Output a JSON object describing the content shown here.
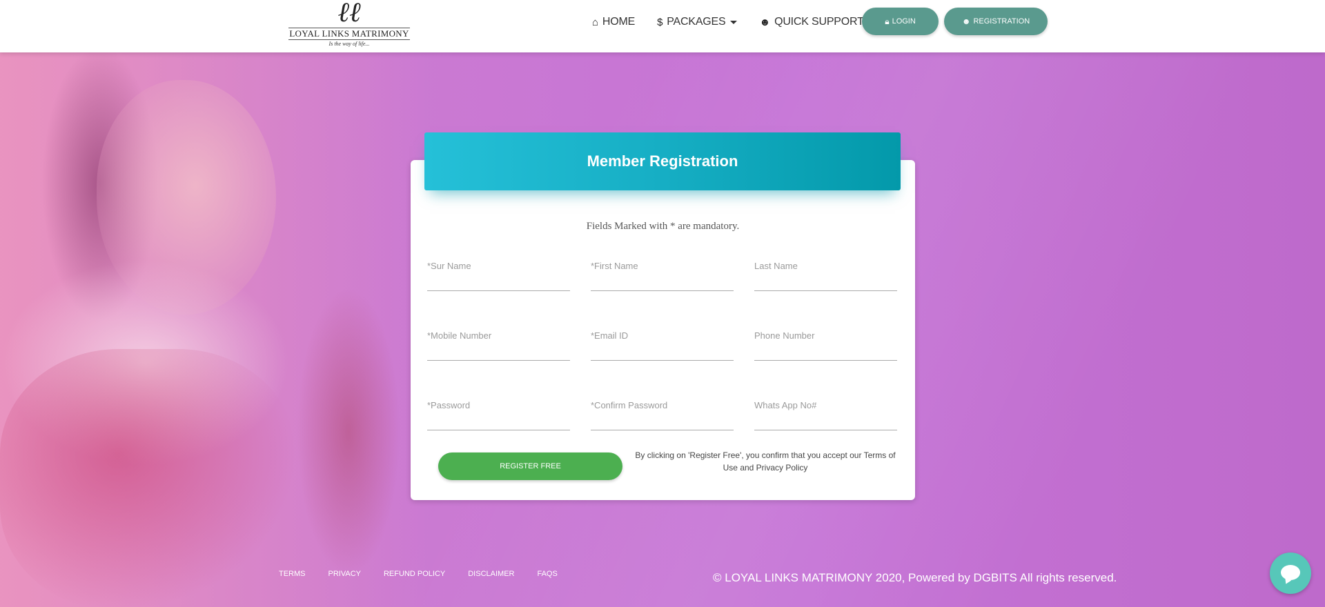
{
  "logo": {
    "mark": "ℓℓ",
    "name": "LOYAL LINKS MATRIMONY",
    "tagline": "Is the way of life..."
  },
  "nav": {
    "home": {
      "label": "HOME",
      "icon": "home-icon"
    },
    "packages": {
      "label": "PACKAGES",
      "icon": "dollar-icon"
    },
    "support": {
      "label": "QUICK SUPPORT",
      "icon": "people-icon"
    },
    "login": {
      "label": "LOGIN",
      "icon": "lock-icon"
    },
    "registration": {
      "label": "REGISTRATION",
      "icon": "user-add-icon"
    }
  },
  "form": {
    "title": "Member Registration",
    "mandatory_note": "Fields Marked with * are mandatory.",
    "fields": [
      {
        "label": "*Sur Name",
        "value": ""
      },
      {
        "label": "*First Name",
        "value": ""
      },
      {
        "label": "Last Name",
        "value": ""
      },
      {
        "label": "*Mobile Number",
        "value": ""
      },
      {
        "label": "*Email ID",
        "value": ""
      },
      {
        "label": "Phone Number",
        "value": ""
      },
      {
        "label": "*Password",
        "value": ""
      },
      {
        "label": "*Confirm Password",
        "value": ""
      },
      {
        "label": "Whats App No#",
        "value": ""
      }
    ],
    "submit_label": "REGISTER FREE",
    "terms_text": "By clicking on 'Register Free', you confirm that you accept our Terms of Use and Privacy Policy"
  },
  "footer": {
    "links": [
      "TERMS",
      "PRIVACY",
      "REFUND POLICY",
      "DISCLAIMER",
      "FAQS"
    ],
    "copyright": "© LOYAL LINKS MATRIMONY 2020, Powered by DGBITS All rights reserved."
  },
  "colors": {
    "header_bg": "#ffffff",
    "pill_button": "#5a9a8e",
    "card_header": "#16aec4",
    "register_button": "#4caf50",
    "chat_button": "#57c7b9",
    "background": "#c573d6"
  },
  "chat": {
    "icon": "chat-bubble-icon"
  }
}
